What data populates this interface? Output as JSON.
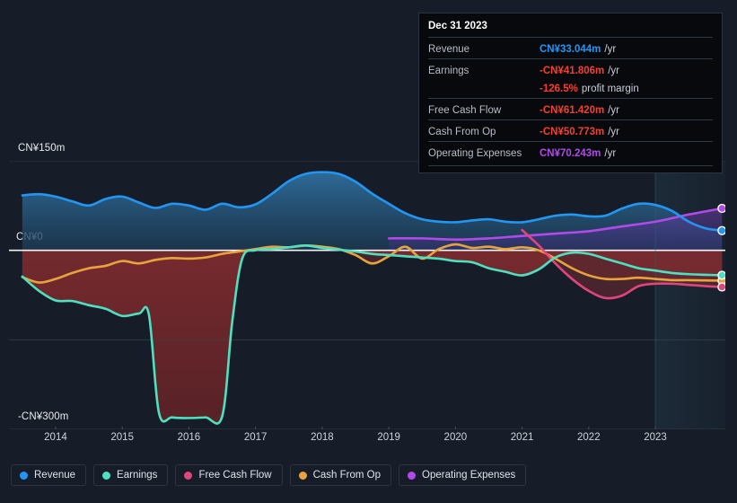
{
  "chart_data": {
    "type": "area",
    "title": "",
    "xlabel": "",
    "ylabel": "",
    "currency": "CN¥",
    "grid": true,
    "legend_position": "bottom-left",
    "ylim": [
      -300,
      150
    ],
    "y_ticks": [
      {
        "value": 150,
        "label": "CN¥150m"
      },
      {
        "value": 0,
        "label": "CN¥0"
      },
      {
        "value": -300,
        "label": "-CN¥300m"
      }
    ],
    "xlim": [
      2013.3,
      2024.05
    ],
    "x_ticks": [
      "2014",
      "2015",
      "2016",
      "2017",
      "2018",
      "2019",
      "2020",
      "2021",
      "2022",
      "2023"
    ],
    "forecast_band_start": 2023.0,
    "series": [
      {
        "name": "Revenue",
        "color": "#2196f3",
        "x": [
          2013.5,
          2013.75,
          2014.0,
          2014.25,
          2014.5,
          2014.75,
          2015.0,
          2015.25,
          2015.5,
          2015.75,
          2016.0,
          2016.25,
          2016.5,
          2016.75,
          2017.0,
          2017.25,
          2017.5,
          2017.75,
          2018.0,
          2018.25,
          2018.5,
          2018.75,
          2019.0,
          2019.25,
          2019.5,
          2019.75,
          2020.0,
          2020.25,
          2020.5,
          2020.75,
          2021.0,
          2021.25,
          2021.5,
          2021.75,
          2022.0,
          2022.25,
          2022.5,
          2022.75,
          2023.0,
          2023.25,
          2023.5,
          2023.75,
          2024.0
        ],
        "values": [
          92,
          94,
          90,
          82,
          75,
          86,
          90,
          80,
          71,
          78,
          75,
          68,
          78,
          72,
          77,
          95,
          116,
          128,
          131,
          128,
          115,
          95,
          78,
          62,
          52,
          48,
          47,
          50,
          52,
          48,
          47,
          52,
          58,
          60,
          57,
          58,
          70,
          78,
          76,
          66,
          48,
          37,
          33
        ]
      },
      {
        "name": "Earnings",
        "color": "#4ee0c0",
        "x": [
          2013.5,
          2013.75,
          2014.0,
          2014.25,
          2014.5,
          2014.75,
          2015.0,
          2015.25,
          2015.4,
          2015.55,
          2015.75,
          2016.0,
          2016.25,
          2016.5,
          2016.65,
          2016.8,
          2017.0,
          2017.25,
          2017.5,
          2017.75,
          2018.0,
          2018.25,
          2018.5,
          2018.75,
          2019.0,
          2019.25,
          2019.5,
          2019.75,
          2020.0,
          2020.25,
          2020.5,
          2020.75,
          2021.0,
          2021.25,
          2021.5,
          2021.75,
          2022.0,
          2022.25,
          2022.5,
          2022.75,
          2023.0,
          2023.25,
          2023.5,
          2023.75,
          2024.0
        ],
        "values": [
          -44,
          -68,
          -84,
          -85,
          -92,
          -98,
          -110,
          -106,
          -108,
          -272,
          -280,
          -281,
          -280,
          -278,
          -120,
          -14,
          0,
          2,
          5,
          8,
          4,
          1,
          -2,
          -6,
          -8,
          -10,
          -12,
          -14,
          -18,
          -20,
          -30,
          -36,
          -42,
          -32,
          -12,
          -4,
          -6,
          -14,
          -22,
          -30,
          -34,
          -38,
          -40,
          -41,
          -41.8
        ]
      },
      {
        "name": "Free Cash Flow",
        "color": "#e0457b",
        "x": [
          2021.0,
          2021.25,
          2021.5,
          2021.75,
          2022.0,
          2022.25,
          2022.5,
          2022.75,
          2023.0,
          2023.25,
          2023.5,
          2023.75,
          2024.0
        ],
        "values": [
          34,
          8,
          -22,
          -48,
          -68,
          -80,
          -76,
          -60,
          -56,
          -56,
          -58,
          -60,
          -61.42
        ]
      },
      {
        "name": "Cash From Op",
        "color": "#e8a33d",
        "x": [
          2013.5,
          2013.75,
          2014.0,
          2014.25,
          2014.5,
          2014.75,
          2015.0,
          2015.25,
          2015.5,
          2015.75,
          2016.0,
          2016.25,
          2016.5,
          2016.75,
          2017.0,
          2017.25,
          2017.5,
          2017.75,
          2018.0,
          2018.25,
          2018.5,
          2018.75,
          2019.0,
          2019.25,
          2019.5,
          2019.75,
          2020.0,
          2020.25,
          2020.5,
          2020.75,
          2021.0,
          2021.25,
          2021.5,
          2021.75,
          2022.0,
          2022.25,
          2022.5,
          2022.75,
          2023.0,
          2023.25,
          2023.5,
          2023.75,
          2024.0
        ],
        "values": [
          -45,
          -54,
          -48,
          -38,
          -30,
          -26,
          -18,
          -22,
          -16,
          -13,
          -14,
          -12,
          -6,
          -2,
          2,
          6,
          5,
          8,
          6,
          2,
          -8,
          -22,
          -10,
          6,
          -14,
          2,
          10,
          4,
          6,
          2,
          5,
          0,
          -14,
          -30,
          -42,
          -48,
          -48,
          -46,
          -48,
          -50,
          -50,
          -50.5,
          -50.77
        ]
      },
      {
        "name": "Operating Expenses",
        "color": "#b04ae8",
        "x": [
          2019.0,
          2019.5,
          2020.0,
          2020.5,
          2021.0,
          2021.5,
          2022.0,
          2022.5,
          2023.0,
          2023.5,
          2024.0
        ],
        "values": [
          20,
          20,
          18,
          20,
          24,
          28,
          32,
          40,
          48,
          60,
          70.243
        ]
      }
    ]
  },
  "tooltip": {
    "title": "Dec 31 2023",
    "unit": "/yr",
    "rows": [
      {
        "label": "Revenue",
        "value": "CN¥33.044m",
        "unit": "/yr",
        "color": "#2196f3"
      },
      {
        "label": "Earnings",
        "value": "-CN¥41.806m",
        "unit": "/yr",
        "color": "#f4402f"
      },
      {
        "label": "",
        "value": "-126.5%",
        "unit": "profit margin",
        "color": "#f4402f"
      },
      {
        "label": "Free Cash Flow",
        "value": "-CN¥61.420m",
        "unit": "/yr",
        "color": "#f4402f"
      },
      {
        "label": "Cash From Op",
        "value": "-CN¥50.773m",
        "unit": "/yr",
        "color": "#f4402f"
      },
      {
        "label": "Operating Expenses",
        "value": "CN¥70.243m",
        "unit": "/yr",
        "color": "#b04ae8"
      }
    ]
  },
  "legend": {
    "items": [
      {
        "label": "Revenue",
        "color": "#2196f3"
      },
      {
        "label": "Earnings",
        "color": "#4ee0c0"
      },
      {
        "label": "Free Cash Flow",
        "color": "#e0457b"
      },
      {
        "label": "Cash From Op",
        "color": "#e8a33d"
      },
      {
        "label": "Operating Expenses",
        "color": "#b04ae8"
      }
    ]
  }
}
